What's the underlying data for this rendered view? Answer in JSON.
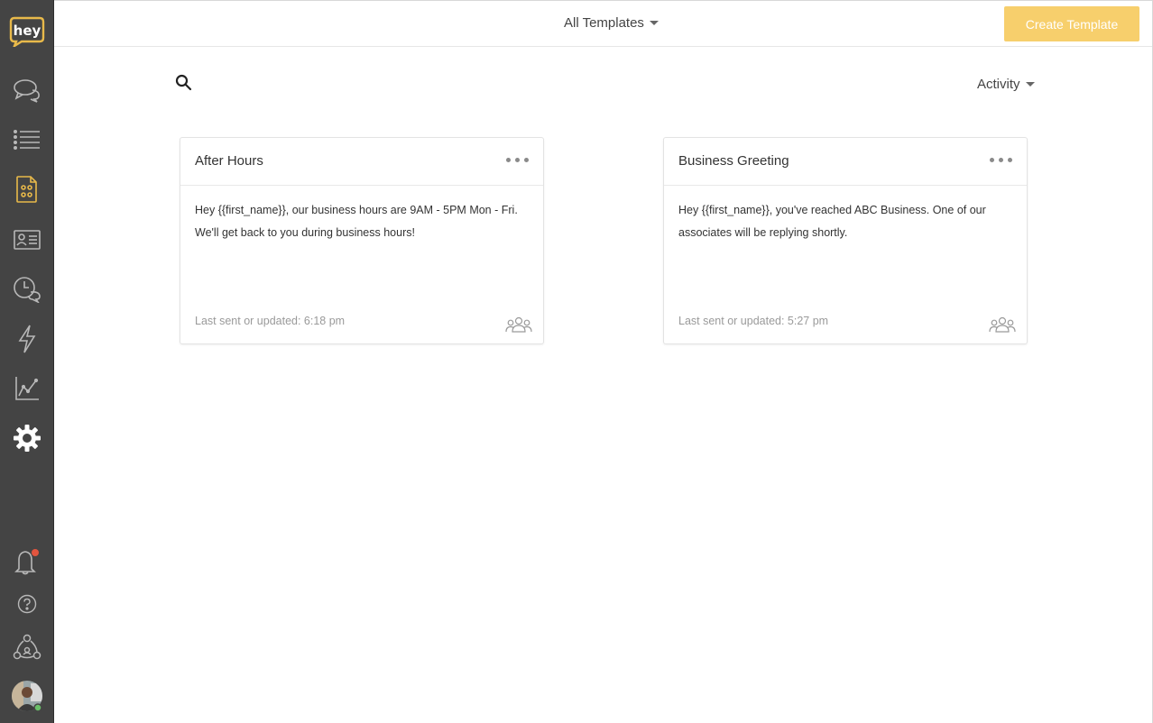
{
  "app": {
    "logo_text": "hey"
  },
  "sidebar": {
    "items": [
      {
        "name": "conversations",
        "icon": "chat-bubbles-icon"
      },
      {
        "name": "lists",
        "icon": "list-icon"
      },
      {
        "name": "templates",
        "icon": "templates-icon",
        "active": true
      },
      {
        "name": "contacts",
        "icon": "contact-card-icon"
      },
      {
        "name": "scheduled",
        "icon": "clock-chat-icon"
      },
      {
        "name": "automations",
        "icon": "lightning-icon"
      },
      {
        "name": "reports",
        "icon": "line-chart-icon"
      },
      {
        "name": "settings",
        "icon": "gear-icon"
      }
    ],
    "bottom": [
      {
        "name": "notifications",
        "icon": "bell-icon",
        "badge": true
      },
      {
        "name": "help",
        "icon": "help-icon"
      },
      {
        "name": "integrations",
        "icon": "network-icon"
      },
      {
        "name": "profile",
        "icon": "avatar"
      }
    ]
  },
  "header": {
    "filter_label": "All Templates",
    "create_label": "Create Template"
  },
  "toolbar": {
    "sort_label": "Activity"
  },
  "templates": [
    {
      "title": "After Hours",
      "line1": "Hey {{first_name}}, our business hours are 9AM - 5PM Mon - Fri.",
      "line2": "We'll get back to you during business hours!",
      "footer": "Last sent or updated: 6:18 pm"
    },
    {
      "title": "Business Greeting",
      "line1": "Hey {{first_name}}, you've reached ABC Business. One of our",
      "line2": "associates will be replying shortly.",
      "footer": "Last sent or updated: 5:27 pm"
    }
  ],
  "colors": {
    "sidebar_bg": "#444444",
    "accent": "#f7cf6c",
    "icon_default": "#b8b8b8",
    "icon_active": "#e8b94a",
    "badge": "#e2553f"
  }
}
